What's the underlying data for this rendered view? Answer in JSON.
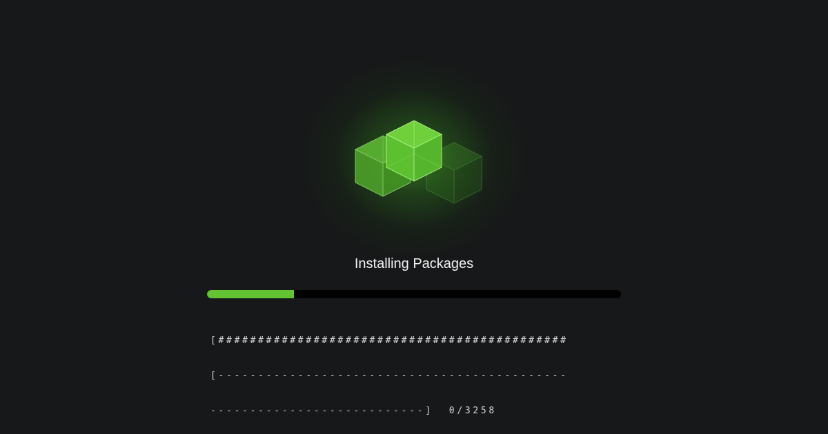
{
  "screen": {
    "title": "Installing Packages",
    "progress_fraction": 0.21,
    "terminal": {
      "line1": "[############################################",
      "line2": "[--------------------------------------------",
      "line3": "---------------------------]  0/3258"
    },
    "icon": "package-cubes-icon"
  },
  "colors": {
    "background": "#17181a",
    "accent": "#62c333",
    "track": "#020202",
    "text": "#f2f2f2"
  }
}
